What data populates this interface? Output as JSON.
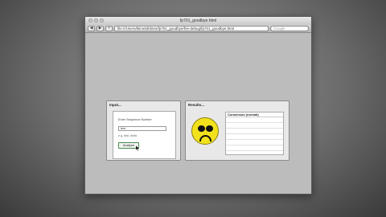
{
  "window": {
    "title": "fp701_goodbye.html",
    "url": "file:///Users/tkimeld/Sites/fp701_goodbye/fire-debug/fp701_goodbye.html",
    "search_placeholder": "Google",
    "back": "◀",
    "forward": "▶",
    "add": "+"
  },
  "input_panel": {
    "title": "Input...",
    "label": "Enter Sequence Number",
    "value": "test",
    "hint": "e.g. ###, ####, ",
    "button": "Analyze"
  },
  "results_panel": {
    "title": "Results...",
    "column_header": "Consensus (normal)",
    "rows": [
      "",
      "",
      "",
      "",
      "",
      ""
    ]
  }
}
